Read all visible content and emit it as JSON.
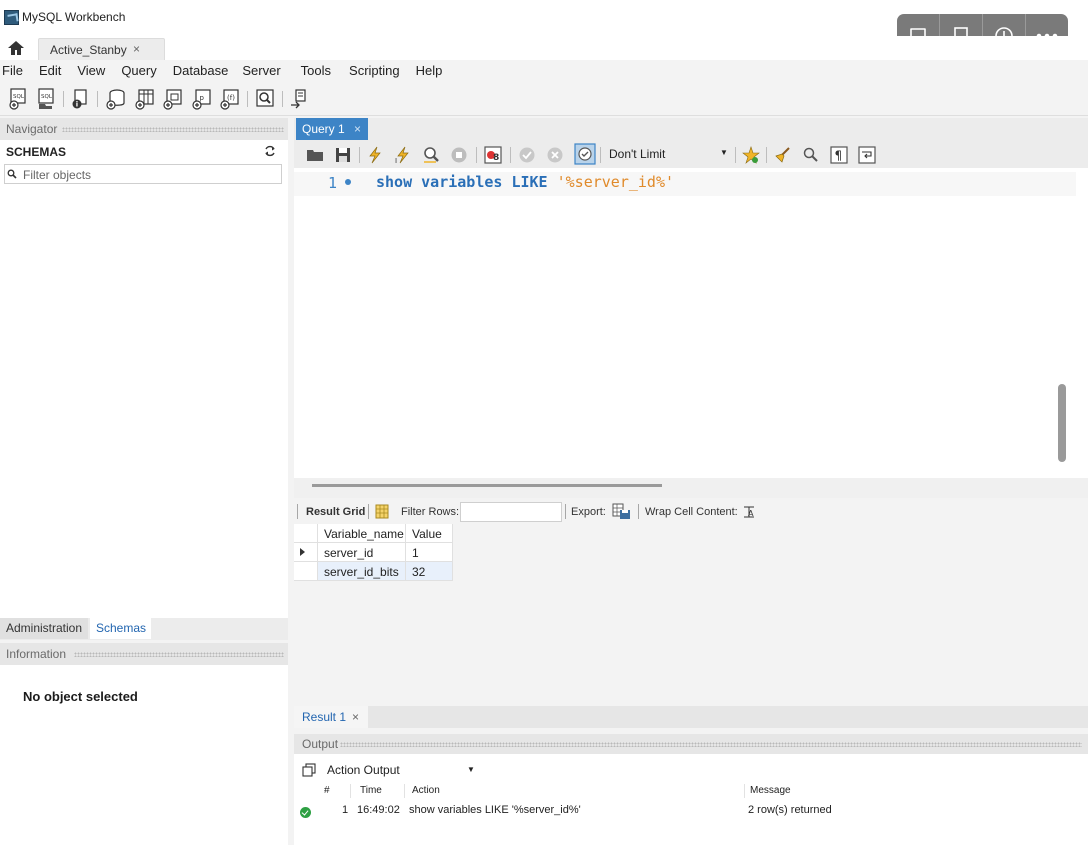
{
  "app": {
    "title": "MySQL Workbench"
  },
  "connection_tab": {
    "label": "Active_Stanby",
    "close": "×"
  },
  "menu": [
    "File",
    "Edit",
    "View",
    "Query",
    "Database",
    "Server",
    "Tools",
    "Scripting",
    "Help"
  ],
  "navigator": {
    "header": "Navigator",
    "schemas_title": "SCHEMAS",
    "filter_placeholder": "Filter objects",
    "tabs": {
      "administration": "Administration",
      "schemas": "Schemas"
    }
  },
  "information": {
    "header": "Information",
    "message": "No object selected"
  },
  "query_tab": {
    "label": "Query 1",
    "close": "×"
  },
  "query_toolbar": {
    "limit": "Don't Limit"
  },
  "editor": {
    "line_number": "1",
    "code": {
      "keyword1": "show",
      "keyword2": "variables",
      "keyword3": "LIKE",
      "string": "'%server_id%'"
    }
  },
  "result_toolbar": {
    "result_grid": "Result Grid",
    "filter_rows": "Filter Rows:",
    "export": "Export:",
    "wrap": "Wrap Cell Content:"
  },
  "grid": {
    "columns": [
      "Variable_name",
      "Value"
    ],
    "rows": [
      {
        "name": "server_id",
        "value": "1"
      },
      {
        "name": "server_id_bits",
        "value": "32"
      }
    ]
  },
  "result_tab": {
    "label": "Result 1",
    "close": "×"
  },
  "output": {
    "header": "Output",
    "selector": "Action Output",
    "columns": {
      "num": "#",
      "time": "Time",
      "action": "Action",
      "message": "Message"
    },
    "rows": [
      {
        "num": "1",
        "time": "16:49:02",
        "action": "show variables LIKE '%server_id%'",
        "message": "2 row(s) returned",
        "status": "ok"
      }
    ]
  },
  "colors": {
    "accent": "#3d84c6",
    "keyword": "#2a6fb7",
    "string": "#e08a2a",
    "ok": "#2ea043"
  }
}
